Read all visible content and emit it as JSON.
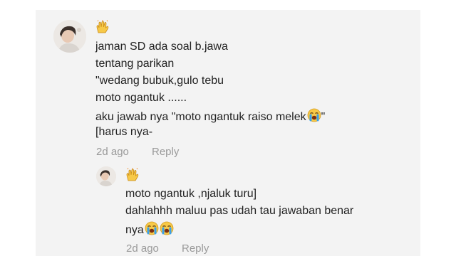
{
  "comment": {
    "lines": [
      "jaman SD ada soal b.jawa",
      "tentang parikan",
      "\"wedang bubuk,gulo tebu",
      "moto ngantuk ......",
      "aku jawab nya \"moto ngantuk raiso melek",
      "[harus nya-"
    ],
    "line5_suffix": "\"",
    "age": "2d ago",
    "reply_label": "Reply"
  },
  "reply": {
    "lines": [
      "moto ngantuk ,njaluk turu]",
      "dahlahhh maluu pas udah tau jawaban benar",
      "nya"
    ],
    "age": "2d ago",
    "reply_label": "Reply"
  },
  "icons": {
    "username_emoji": "raised-hands-emoji",
    "crying_emoji": "loudly-crying-face-emoji"
  },
  "colors": {
    "panel_bg": "#f3f3f3",
    "text": "#222222",
    "meta": "#9a9a9a",
    "emoji_yellow": "#f7c948",
    "emoji_blue": "#3aa0e8"
  }
}
